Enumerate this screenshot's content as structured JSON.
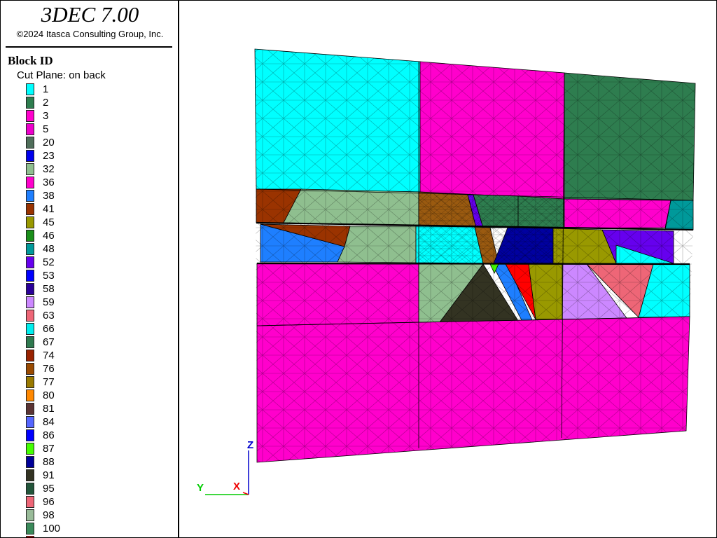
{
  "app": {
    "title": "3DEC 7.00",
    "copyright": "©2024 Itasca Consulting Group, Inc."
  },
  "legend": {
    "title": "Block  ID",
    "cut_plane": "Cut Plane: on back",
    "items": [
      {
        "label": "1",
        "color": "#00ffff"
      },
      {
        "label": "2",
        "color": "#2e7d4f"
      },
      {
        "label": "3",
        "color": "#ff00cc"
      },
      {
        "label": "5",
        "color": "#ee00cc"
      },
      {
        "label": "20",
        "color": "#4f6e5a"
      },
      {
        "label": "23",
        "color": "#0000ee"
      },
      {
        "label": "32",
        "color": "#8fbf8f"
      },
      {
        "label": "36",
        "color": "#ff00cc"
      },
      {
        "label": "38",
        "color": "#1e7fff"
      },
      {
        "label": "41",
        "color": "#9a3300"
      },
      {
        "label": "45",
        "color": "#999900"
      },
      {
        "label": "46",
        "color": "#1a8f1a"
      },
      {
        "label": "48",
        "color": "#00999a"
      },
      {
        "label": "52",
        "color": "#6600ee"
      },
      {
        "label": "53",
        "color": "#0000ff"
      },
      {
        "label": "58",
        "color": "#2a0099"
      },
      {
        "label": "59",
        "color": "#cc88ff"
      },
      {
        "label": "63",
        "color": "#ee6677"
      },
      {
        "label": "66",
        "color": "#00eeee"
      },
      {
        "label": "67",
        "color": "#2f7a4f"
      },
      {
        "label": "74",
        "color": "#992200"
      },
      {
        "label": "76",
        "color": "#9a4a00"
      },
      {
        "label": "77",
        "color": "#9a7a00"
      },
      {
        "label": "80",
        "color": "#ff8800"
      },
      {
        "label": "81",
        "color": "#5a3333"
      },
      {
        "label": "84",
        "color": "#5566ff"
      },
      {
        "label": "86",
        "color": "#0000ff"
      },
      {
        "label": "87",
        "color": "#44ff00"
      },
      {
        "label": "88",
        "color": "#000099"
      },
      {
        "label": "91",
        "color": "#333322"
      },
      {
        "label": "95",
        "color": "#22553a"
      },
      {
        "label": "96",
        "color": "#ee6677"
      },
      {
        "label": "98",
        "color": "#99bb99"
      },
      {
        "label": "100",
        "color": "#3a8a5a"
      },
      {
        "label": "",
        "color": "#ff0000"
      }
    ]
  },
  "axes": {
    "z_label": "Z",
    "y_label": "Y",
    "x_label": "X",
    "z_color": "#0000cc",
    "y_color": "#00cc00",
    "x_color": "#ee0000"
  },
  "model": {
    "colors": {
      "cyan": "#00ffff",
      "magenta": "#ff00cc",
      "green": "#2e7d4f",
      "brown": "#9a3300",
      "sage": "#8fbf8f",
      "olive_brown": "#9a5a10",
      "teal": "#00999a",
      "blue": "#1e7fff",
      "navy": "#0000a0",
      "olive": "#999900",
      "purple": "#6600ee",
      "lilac": "#cc88ff",
      "salmon": "#ee6677",
      "dark": "#333322",
      "red": "#ff0000",
      "lime": "#44ff00"
    }
  }
}
